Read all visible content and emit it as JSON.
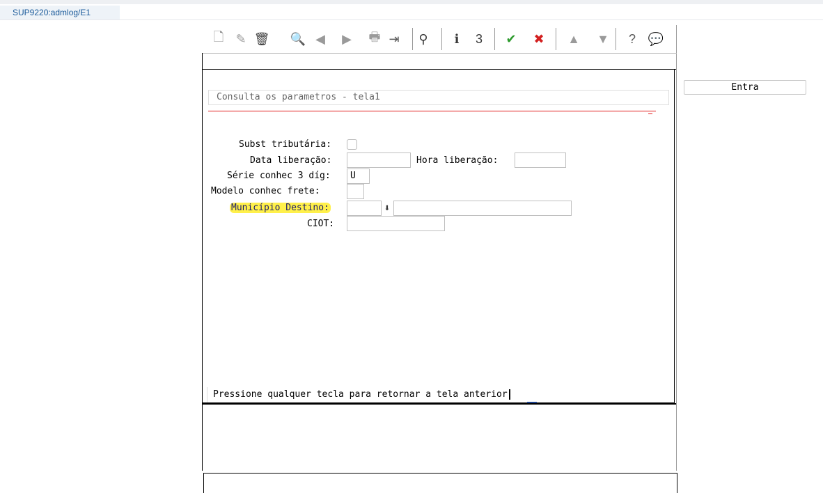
{
  "window": {
    "title": "SUP9220:admlog/E1"
  },
  "toolbar": {
    "buttons": [
      {
        "icon": "new-document-icon",
        "glyph": "🗋",
        "color": "#8a8a8a"
      },
      {
        "icon": "edit-icon",
        "glyph": "✎",
        "color": "#9a9a9a"
      },
      {
        "icon": "delete-trash-icon",
        "glyph": "🗑",
        "color": "#3a3a3a"
      },
      {
        "icon": "search-magnifier-icon",
        "glyph": "🔍",
        "color": "#7a7a7a"
      },
      {
        "icon": "previous-record-icon",
        "glyph": "◀",
        "color": "#9a9a9a"
      },
      {
        "icon": "next-record-icon",
        "glyph": "▶",
        "color": "#9a9a9a"
      },
      {
        "icon": "print-icon",
        "glyph": "🖶",
        "color": "#9a9a9a"
      },
      {
        "icon": "exit-door-icon",
        "glyph": "⇥",
        "color": "#5a5a5a"
      },
      {
        "icon": "binoculars-icon",
        "glyph": "⚲",
        "color": "#3a3a3a"
      },
      {
        "icon": "info-icon",
        "glyph": "ℹ",
        "color": "#3a3a3a"
      },
      {
        "icon": "numbered-list-icon",
        "glyph": "3",
        "color": "#3a3a3a"
      },
      {
        "icon": "confirm-check-icon",
        "glyph": "✔",
        "color": "#2e9b2e"
      },
      {
        "icon": "cancel-x-icon",
        "glyph": "✖",
        "color": "#d32020"
      },
      {
        "icon": "scroll-up-icon",
        "glyph": "▲",
        "color": "#9a9a9a"
      },
      {
        "icon": "scroll-down-icon",
        "glyph": "▼",
        "color": "#9a9a9a"
      },
      {
        "icon": "help-question-icon",
        "glyph": "?",
        "color": "#5a5a5a"
      },
      {
        "icon": "comment-bubble-icon",
        "glyph": "💬",
        "color": "#5a5a5a"
      }
    ]
  },
  "screen": {
    "title": "Consulta os parametros - tela1",
    "fields": {
      "subst_tributaria_label": "Subst tributária:",
      "data_liberacao_label": "Data liberação:",
      "hora_liberacao_label": "Hora liberação:",
      "serie_label": "Série conhec 3 díg:",
      "serie_value": "U",
      "modelo_label": "Modelo conhec frete:",
      "municipio_label": "Município Destino:",
      "ciot_label": "CIOT:"
    },
    "message": "Pressione qualquer tecla para retornar a tela anterior"
  },
  "side": {
    "entra_label": "Entra"
  },
  "colors": {
    "accent_red": "#e21b1b",
    "highlight": "#fff04a",
    "check_green": "#2e9b2e"
  }
}
